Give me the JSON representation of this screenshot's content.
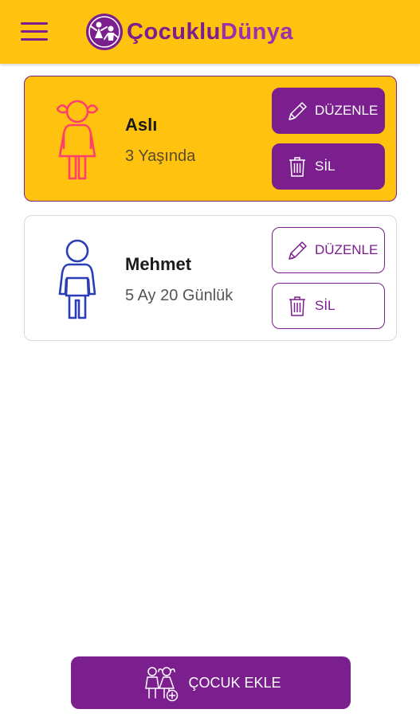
{
  "app": {
    "logo_part1": "Çocuklu",
    "logo_part2": "Dünya"
  },
  "children": [
    {
      "name": "Aslı",
      "age": "3 Yaşında",
      "avatar_icon": "girl-icon",
      "edit_label": "DÜZENLE",
      "delete_label": "SİL",
      "selected": true
    },
    {
      "name": "Mehmet",
      "age": "5 Ay 20 Günlük",
      "avatar_icon": "boy-icon",
      "edit_label": "DÜZENLE",
      "delete_label": "SİL",
      "selected": false
    }
  ],
  "footer": {
    "add_child_label": "ÇOCUK EKLE",
    "add_icon": "children-add-icon"
  },
  "colors": {
    "primary_purple": "#7b1e8e",
    "accent_yellow": "#ffc20e",
    "girl_pink": "#ff3f6c",
    "boy_blue": "#2a3fb6"
  }
}
